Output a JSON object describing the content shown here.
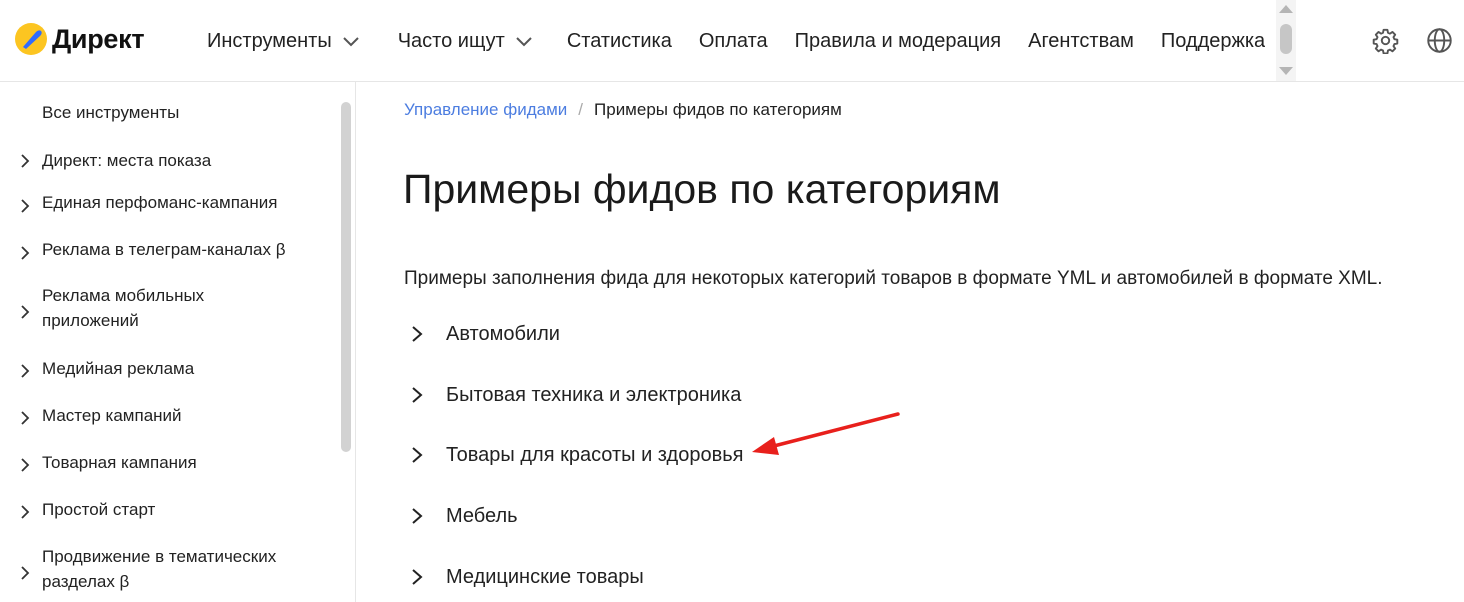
{
  "header": {
    "logo_text": "Директ",
    "nav": [
      {
        "label": "Инструменты",
        "has_dropdown": true
      },
      {
        "label": "Часто ищут",
        "has_dropdown": true
      },
      {
        "label": "Статистика",
        "has_dropdown": false
      },
      {
        "label": "Оплата",
        "has_dropdown": false
      },
      {
        "label": "Правила и модерация",
        "has_dropdown": false
      },
      {
        "label": "Агентствам",
        "has_dropdown": false
      },
      {
        "label": "Поддержка",
        "has_dropdown": false
      }
    ],
    "icons": [
      "gear-icon",
      "globe-icon"
    ]
  },
  "sidebar": {
    "items": [
      {
        "label": "Все инструменты",
        "expandable": false
      },
      {
        "label": "Директ: места показа",
        "expandable": true
      },
      {
        "label": "Единая перфоманс-кампания",
        "expandable": true
      },
      {
        "label": "Реклама в телеграм-каналах β",
        "expandable": true
      },
      {
        "label": "Реклама мобильных приложений",
        "expandable": true
      },
      {
        "label": "Медийная реклама",
        "expandable": true
      },
      {
        "label": "Мастер кампаний",
        "expandable": true
      },
      {
        "label": "Товарная кампания",
        "expandable": true
      },
      {
        "label": "Простой старт",
        "expandable": true
      },
      {
        "label": "Продвижение в тематических разделах β",
        "expandable": true
      }
    ]
  },
  "breadcrumb": {
    "parent": "Управление фидами",
    "separator": "/",
    "current": "Примеры фидов по категориям"
  },
  "main": {
    "title": "Примеры фидов по категориям",
    "intro": "Примеры заполнения фида для некоторых категорий товаров в формате YML и автомобилей в формате XML.",
    "categories": [
      "Автомобили",
      "Бытовая техника и электроника",
      "Товары для красоты и здоровья",
      "Мебель",
      "Медицинские товары"
    ]
  },
  "colors": {
    "link": "#4c7de0",
    "logo_yellow": "#fcc521",
    "logo_blue": "#2f6bff",
    "annotation_arrow": "#e8201c"
  }
}
